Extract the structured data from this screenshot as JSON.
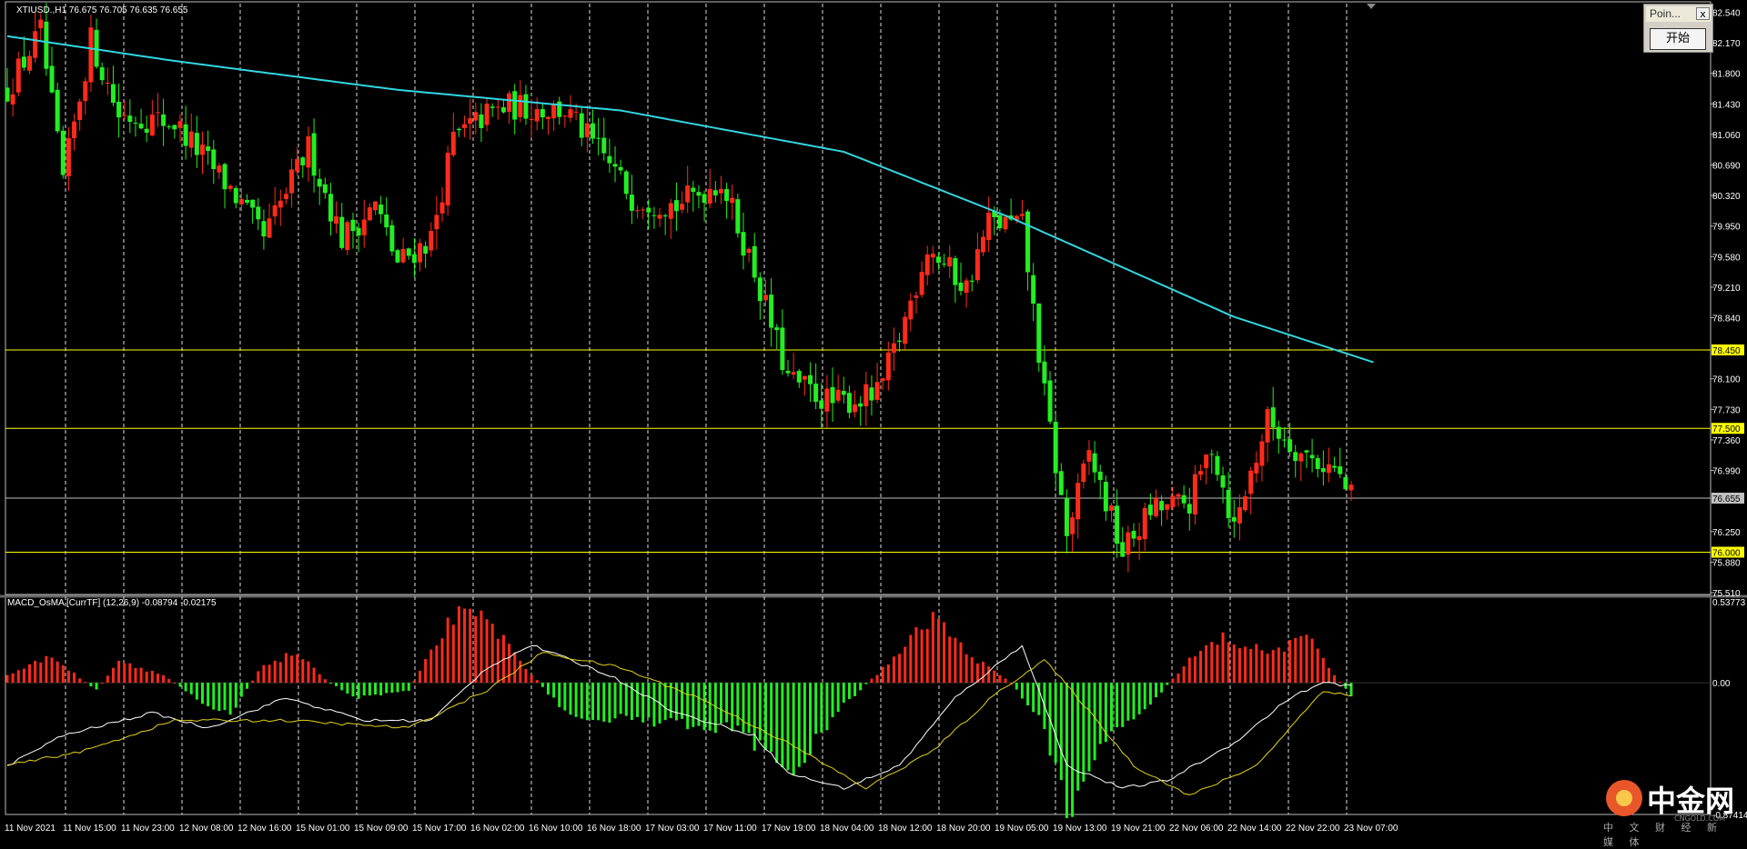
{
  "chart_data": [
    {
      "type": "candlestick",
      "title": "XTIUSD.,H1  76.675 76.705 76.635 76.655",
      "ylim": [
        75.51,
        82.6
      ],
      "y_ticks": [
        "82.540",
        "82.170",
        "81.800",
        "81.430",
        "81.060",
        "80.690",
        "80.320",
        "79.950",
        "79.580",
        "79.210",
        "78.840",
        "78.450",
        "78.100",
        "77.730",
        "77.500",
        "77.360",
        "76.990",
        "76.655",
        "76.250",
        "76.000",
        "75.880",
        "75.510"
      ],
      "x_labels": [
        "11 Nov 2021",
        "11 Nov 15:00",
        "11 Nov 23:00",
        "12 Nov 08:00",
        "12 Nov 16:00",
        "15 Nov 01:00",
        "15 Nov 09:00",
        "15 Nov 17:00",
        "16 Nov 02:00",
        "16 Nov 10:00",
        "16 Nov 18:00",
        "17 Nov 03:00",
        "17 Nov 11:00",
        "17 Nov 19:00",
        "18 Nov 04:00",
        "18 Nov 12:00",
        "18 Nov 20:00",
        "19 Nov 05:00",
        "19 Nov 13:00",
        "19 Nov 21:00",
        "22 Nov 06:00",
        "22 Nov 14:00",
        "22 Nov 22:00",
        "23 Nov 07:00"
      ],
      "horizontal_levels": [
        {
          "value": 78.45,
          "label": "78.450",
          "color": "#ffff00"
        },
        {
          "value": 77.5,
          "label": "77.500",
          "color": "#ffff00"
        },
        {
          "value": 76.0,
          "label": "76.000",
          "color": "#ffff00"
        },
        {
          "value": 76.655,
          "label": "76.655",
          "color": "#c0c0c0"
        }
      ],
      "bull_color": "#ff2a1a",
      "bear_color": "#22ee22",
      "ma_color": "#33d6e0",
      "ma_anchors": [
        [
          0,
          82.25
        ],
        [
          30,
          81.95
        ],
        [
          70,
          81.6
        ],
        [
          110,
          81.35
        ],
        [
          150,
          80.85
        ],
        [
          180,
          80.05
        ],
        [
          220,
          78.85
        ],
        [
          245,
          78.3
        ]
      ],
      "close_anchors": [
        [
          0,
          81.6
        ],
        [
          6,
          82.3
        ],
        [
          10,
          80.5
        ],
        [
          15,
          82.2
        ],
        [
          20,
          81.3
        ],
        [
          30,
          81.2
        ],
        [
          40,
          80.4
        ],
        [
          46,
          79.8
        ],
        [
          54,
          80.9
        ],
        [
          60,
          79.8
        ],
        [
          66,
          80.2
        ],
        [
          70,
          79.5
        ],
        [
          76,
          79.8
        ],
        [
          80,
          81.0
        ],
        [
          86,
          81.3
        ],
        [
          90,
          81.4
        ],
        [
          100,
          81.35
        ],
        [
          108,
          80.7
        ],
        [
          112,
          80.3
        ],
        [
          120,
          80.2
        ],
        [
          128,
          80.5
        ],
        [
          134,
          79.4
        ],
        [
          140,
          78.1
        ],
        [
          148,
          77.8
        ],
        [
          156,
          77.9
        ],
        [
          160,
          78.6
        ],
        [
          165,
          79.7
        ],
        [
          172,
          79.2
        ],
        [
          176,
          80.0
        ],
        [
          182,
          79.95
        ],
        [
          186,
          77.9
        ],
        [
          190,
          76.2
        ],
        [
          194,
          77.2
        ],
        [
          200,
          76.0
        ],
        [
          205,
          76.5
        ],
        [
          212,
          76.6
        ],
        [
          216,
          77.3
        ],
        [
          220,
          76.3
        ],
        [
          226,
          77.6
        ],
        [
          232,
          77.2
        ],
        [
          238,
          77.0
        ],
        [
          241,
          76.655
        ]
      ]
    },
    {
      "type": "histogram+lines",
      "title": "MACD_OsMA [CurrTF] (12,26,9) -0.08794 -0.02175",
      "ylim": [
        -0.874149,
        0.53773
      ],
      "y_ticks": [
        "0.53773",
        "0.00",
        "-0.874149"
      ],
      "pos_color": "#ff2a1a",
      "neg_color": "#22ee22",
      "macd_color": "#ffffff",
      "signal_color": "#e6d21a",
      "osma_anchors": [
        [
          0,
          0.05
        ],
        [
          8,
          0.18
        ],
        [
          12,
          0.06
        ],
        [
          16,
          -0.05
        ],
        [
          20,
          0.15
        ],
        [
          28,
          0.05
        ],
        [
          36,
          -0.15
        ],
        [
          40,
          -0.2
        ],
        [
          46,
          0.12
        ],
        [
          52,
          0.2
        ],
        [
          56,
          0.05
        ],
        [
          62,
          -0.1
        ],
        [
          72,
          -0.05
        ],
        [
          80,
          0.45
        ],
        [
          86,
          0.42
        ],
        [
          92,
          0.15
        ],
        [
          100,
          -0.2
        ],
        [
          112,
          -0.25
        ],
        [
          130,
          -0.3
        ],
        [
          140,
          -0.6
        ],
        [
          150,
          -0.15
        ],
        [
          160,
          0.2
        ],
        [
          166,
          0.45
        ],
        [
          172,
          0.2
        ],
        [
          180,
          0.0
        ],
        [
          186,
          -0.3
        ],
        [
          190,
          -0.85
        ],
        [
          196,
          -0.4
        ],
        [
          206,
          -0.1
        ],
        [
          212,
          0.15
        ],
        [
          218,
          0.3
        ],
        [
          226,
          0.2
        ],
        [
          234,
          0.3
        ],
        [
          238,
          0.05
        ],
        [
          241,
          -0.08
        ]
      ],
      "macd_anchors": [
        [
          0,
          -0.55
        ],
        [
          10,
          -0.35
        ],
        [
          26,
          -0.2
        ],
        [
          36,
          -0.3
        ],
        [
          50,
          -0.1
        ],
        [
          64,
          -0.25
        ],
        [
          76,
          -0.25
        ],
        [
          86,
          0.1
        ],
        [
          94,
          0.25
        ],
        [
          108,
          0.05
        ],
        [
          120,
          -0.2
        ],
        [
          134,
          -0.35
        ],
        [
          140,
          -0.6
        ],
        [
          150,
          -0.7
        ],
        [
          160,
          -0.55
        ],
        [
          170,
          -0.1
        ],
        [
          182,
          0.25
        ],
        [
          190,
          -0.55
        ],
        [
          200,
          -0.7
        ],
        [
          208,
          -0.65
        ],
        [
          220,
          -0.4
        ],
        [
          230,
          -0.1
        ],
        [
          236,
          0.0
        ],
        [
          241,
          -0.02
        ]
      ],
      "signal_anchors": [
        [
          0,
          -0.55
        ],
        [
          14,
          -0.45
        ],
        [
          30,
          -0.25
        ],
        [
          50,
          -0.25
        ],
        [
          72,
          -0.3
        ],
        [
          86,
          -0.05
        ],
        [
          96,
          0.2
        ],
        [
          110,
          0.1
        ],
        [
          124,
          -0.1
        ],
        [
          140,
          -0.4
        ],
        [
          154,
          -0.7
        ],
        [
          166,
          -0.45
        ],
        [
          178,
          -0.05
        ],
        [
          186,
          0.15
        ],
        [
          192,
          -0.1
        ],
        [
          202,
          -0.55
        ],
        [
          212,
          -0.75
        ],
        [
          224,
          -0.55
        ],
        [
          236,
          -0.05
        ],
        [
          241,
          -0.09
        ]
      ]
    }
  ],
  "dialog": {
    "title": "Poin...",
    "close": "x",
    "button": "开始"
  },
  "watermark": {
    "name": "中金网",
    "sub": "中 文 财 经 新 媒 体",
    "site": "CNGOLD.COM"
  }
}
